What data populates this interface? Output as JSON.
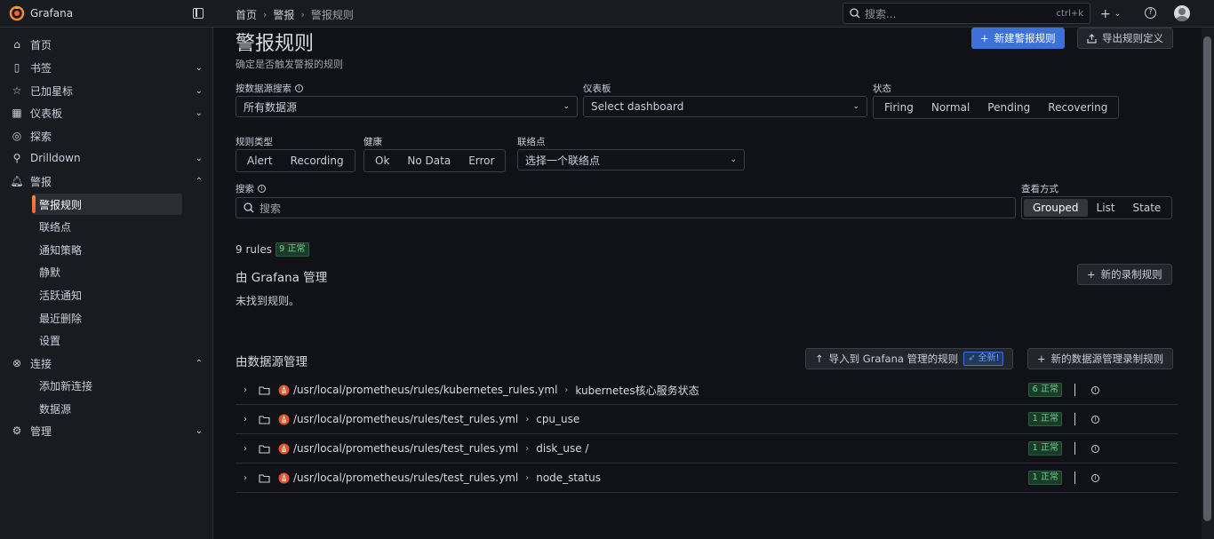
{
  "app": {
    "name": "Grafana"
  },
  "breadcrumb": {
    "home": "首页",
    "alerting": "警报",
    "current": "警报规则"
  },
  "topbar": {
    "search_placeholder": "搜索...",
    "search_shortcut": "ctrl+k",
    "plus": "+"
  },
  "sidebar": {
    "items": [
      {
        "label": "首页",
        "icon": "home-icon"
      },
      {
        "label": "书签",
        "icon": "bookmark-icon"
      },
      {
        "label": "已加星标",
        "icon": "star-icon"
      },
      {
        "label": "仪表板",
        "icon": "dashboard-icon"
      },
      {
        "label": "探索",
        "icon": "compass-icon"
      },
      {
        "label": "Drilldown",
        "icon": "drilldown-icon"
      },
      {
        "label": "警报",
        "icon": "bell-icon"
      },
      {
        "label": "连接",
        "icon": "connection-icon"
      },
      {
        "label": "管理",
        "icon": "gear-icon"
      }
    ],
    "alerting_sub": [
      "警报规则",
      "联络点",
      "通知策略",
      "静默",
      "活跃通知",
      "最近删除",
      "设置"
    ],
    "connections_sub": [
      "添加新连接",
      "数据源"
    ]
  },
  "page": {
    "title": "警报规则",
    "subtitle": "确定是否触发警报的规则",
    "new_rule_button": "新建警报规则",
    "export_button": "导出规则定义"
  },
  "filters": {
    "datasource_label": "按数据源搜索",
    "datasource_value": "所有数据源",
    "dashboard_label": "仪表板",
    "dashboard_value": "Select dashboard",
    "state_label": "状态",
    "state_options": [
      "Firing",
      "Normal",
      "Pending",
      "Recovering"
    ],
    "rule_type_label": "规则类型",
    "rule_type_options": [
      "Alert",
      "Recording"
    ],
    "health_label": "健康",
    "health_options": [
      "Ok",
      "No Data",
      "Error"
    ],
    "contact_label": "联络点",
    "contact_value": "选择一个联络点",
    "search_label": "搜索",
    "search_placeholder": "搜索",
    "view_label": "查看方式",
    "view_options": [
      "Grouped",
      "List",
      "State"
    ],
    "view_selected": "Grouped"
  },
  "summary": {
    "rules_count": "9 rules",
    "normal_badge": "9 正常"
  },
  "grafana_managed": {
    "title": "由 Grafana 管理",
    "new_recording_button": "新的录制规则",
    "empty_text": "未找到规则。"
  },
  "datasource_managed": {
    "title": "由数据源管理",
    "import_button": "导入到 Grafana 管理的规则",
    "new_tag": "全新!",
    "new_ds_recording_button": "新的数据源管理录制规则",
    "rows": [
      {
        "path": "/usr/local/prometheus/rules/kubernetes_rules.yml",
        "group": "kubernetes核心服务状态",
        "badge": "6 正常"
      },
      {
        "path": "/usr/local/prometheus/rules/test_rules.yml",
        "group": "cpu_use",
        "badge": "1 正常"
      },
      {
        "path": "/usr/local/prometheus/rules/test_rules.yml",
        "group": "disk_use /",
        "badge": "1 正常"
      },
      {
        "path": "/usr/local/prometheus/rules/test_rules.yml",
        "group": "node_status",
        "badge": "1 正常"
      }
    ]
  },
  "colors": {
    "primary": "#3d71d9",
    "background": "#111217",
    "panel": "#181b1f",
    "ok": "#6ccf8e",
    "brand": "#f55f3e"
  }
}
